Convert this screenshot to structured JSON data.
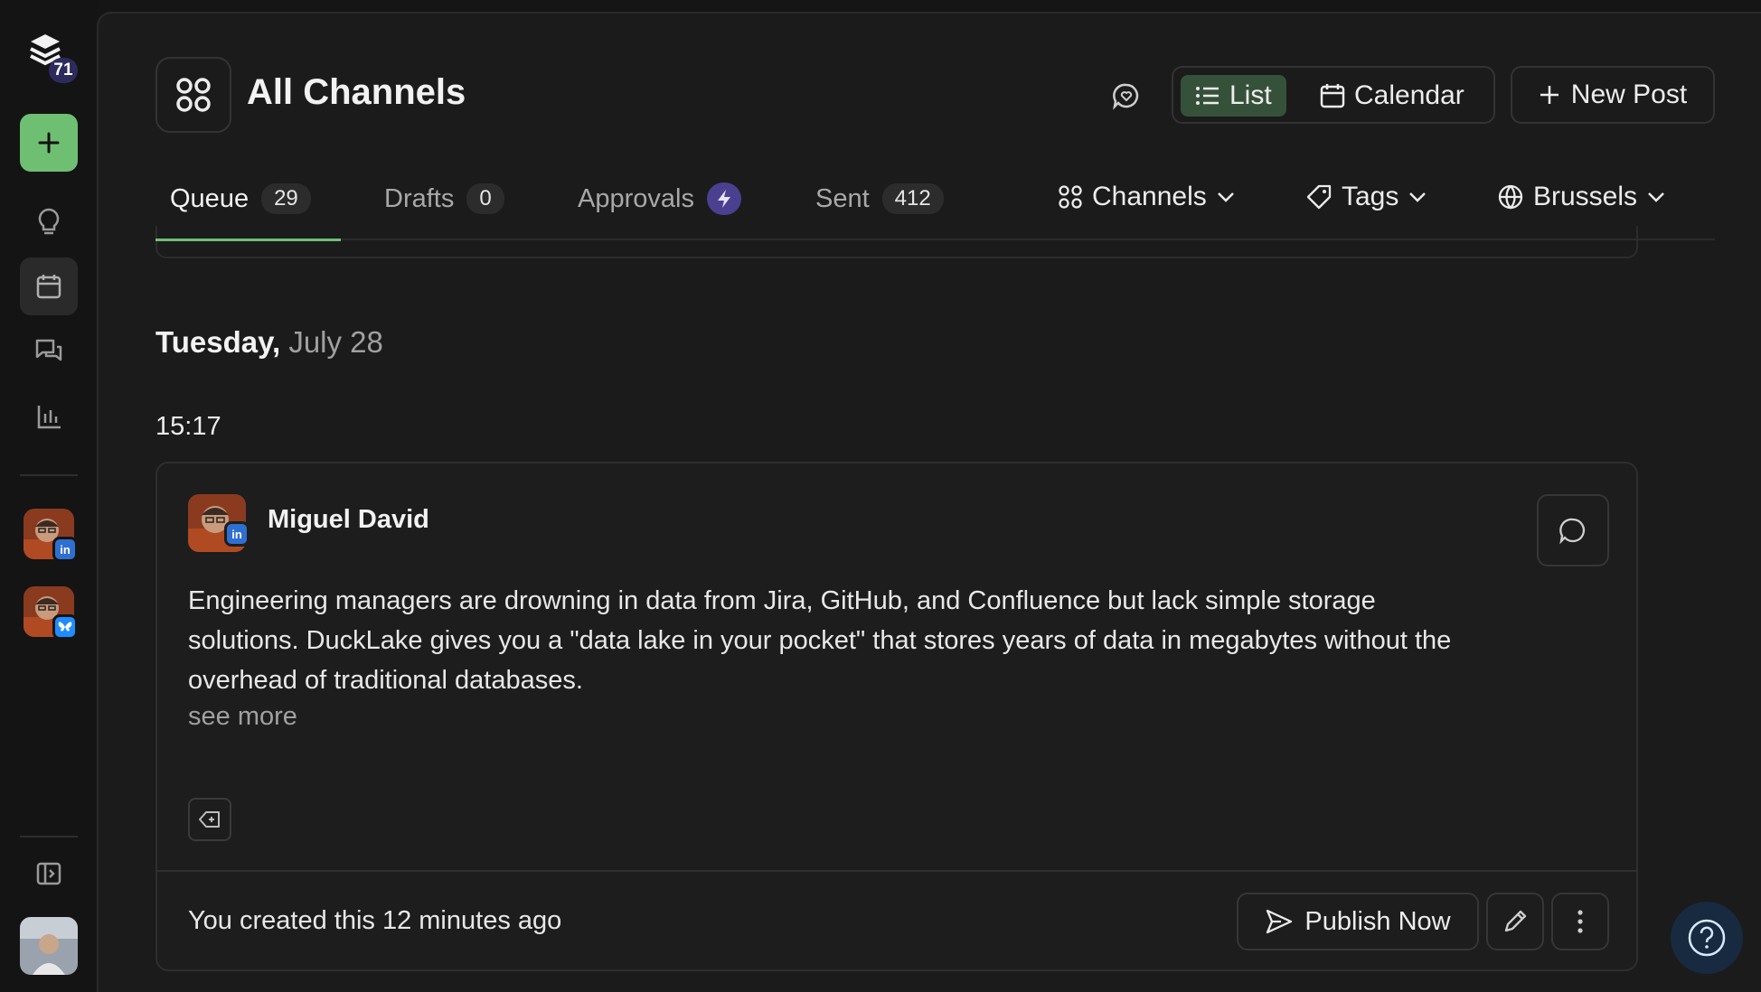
{
  "sidebar": {
    "notification_count": "71",
    "colors": {
      "create": "#6fbf73",
      "badge": "#2d2b5e"
    },
    "nav_icons": [
      "create-icon",
      "lightbulb-icon",
      "calendar-icon",
      "chat-icon",
      "analytics-icon"
    ],
    "channels": [
      {
        "name": "Miguel David LinkedIn",
        "network": "linkedin",
        "badge_color": "#2f6fd0"
      },
      {
        "name": "Miguel David Bluesky",
        "network": "bluesky",
        "badge_color": "#1f8cff"
      }
    ]
  },
  "header": {
    "title": "All Channels",
    "view_toggle": {
      "list": "List",
      "calendar": "Calendar",
      "selected": "List"
    },
    "new_post": "New Post"
  },
  "tabs": [
    {
      "label": "Queue",
      "count": "29",
      "active": true
    },
    {
      "label": "Drafts",
      "count": "0"
    },
    {
      "label": "Approvals",
      "icon": "bolt-icon"
    },
    {
      "label": "Sent",
      "count": "412"
    }
  ],
  "filters": {
    "channels": "Channels",
    "tags": "Tags",
    "timezone": "Brussels"
  },
  "schedule": {
    "day": "Tuesday,",
    "date": "July 28",
    "time": "15:17"
  },
  "post": {
    "author": "Miguel David",
    "network": "linkedin",
    "text": "Engineering managers are drowning in data from Jira, GitHub, and Confluence but lack simple storage solutions. DuckLake gives you a \"data lake in your pocket\" that stores years of data in megabytes without the overhead of traditional databases.",
    "see_more": "see more",
    "created": "You created this 12 minutes ago",
    "publish_now": "Publish Now"
  },
  "accent_color": "#6fbf73"
}
